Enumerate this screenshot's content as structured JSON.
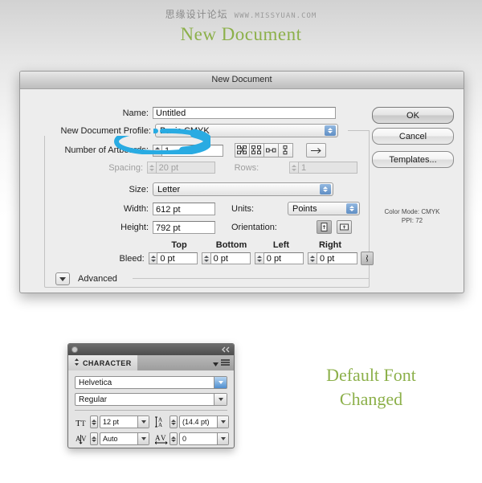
{
  "watermark": {
    "cn_text": "思缘设计论坛",
    "url": "WWW.MISSYUAN.COM"
  },
  "header": {
    "title": "New Document"
  },
  "dialog": {
    "title": "New Document",
    "name_label": "Name:",
    "name_value": "Untitled",
    "profile_label": "New Document Profile:",
    "profile_value": "Basic CMYK",
    "artboards_label": "Number of Artboards:",
    "artboards_value": "1",
    "spacing_label": "Spacing:",
    "spacing_value": "20 pt",
    "rows_label": "Rows:",
    "rows_value": "1",
    "size_label": "Size:",
    "size_value": "Letter",
    "width_label": "Width:",
    "width_value": "612 pt",
    "units_label": "Units:",
    "units_value": "Points",
    "height_label": "Height:",
    "height_value": "792 pt",
    "orientation_label": "Orientation:",
    "bleed_label": "Bleed:",
    "bleed_top_header": "Top",
    "bleed_bottom_header": "Bottom",
    "bleed_left_header": "Left",
    "bleed_right_header": "Right",
    "bleed_top_value": "0 pt",
    "bleed_bottom_value": "0 pt",
    "bleed_left_value": "0 pt",
    "bleed_right_value": "0 pt",
    "advanced_label": "Advanced",
    "ok_label": "OK",
    "cancel_label": "Cancel",
    "templates_label": "Templates...",
    "color_mode_text": "Color Mode: CMYK",
    "ppi_text": "PPI: 72"
  },
  "annotation": {
    "ellipse_color": "#29ABE2",
    "note_text_line1": "Default Font",
    "note_text_line2": "Changed"
  },
  "character_panel": {
    "tab_label": "CHARACTER",
    "font_family": "Helvetica",
    "font_style": "Regular",
    "font_size": "12 pt",
    "leading": "(14.4 pt)",
    "kerning": "Auto",
    "tracking": "0"
  }
}
